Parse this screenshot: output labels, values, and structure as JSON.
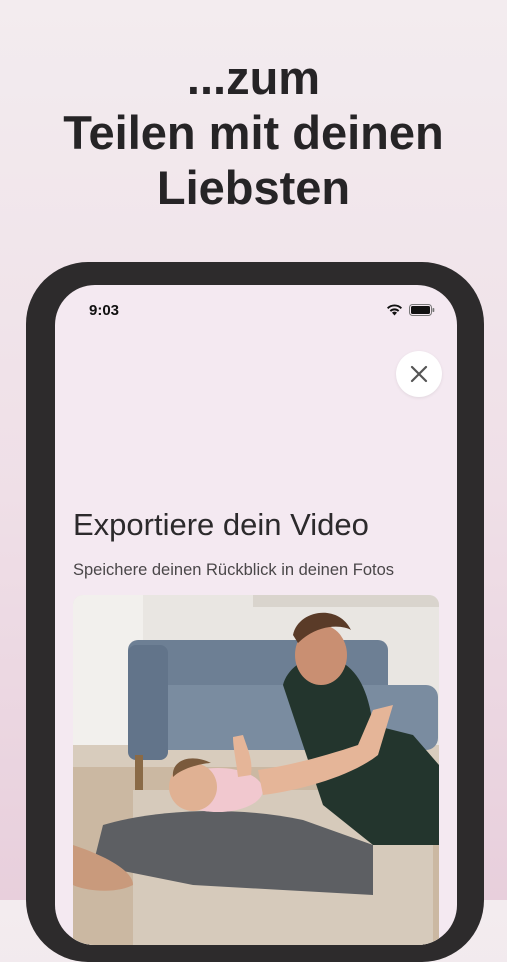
{
  "headline": {
    "line1": "...zum",
    "line2": "Teilen mit deinen",
    "line3": "Liebsten"
  },
  "status_bar": {
    "time": "9:03",
    "icons": [
      "wifi-icon",
      "battery-icon"
    ]
  },
  "screen": {
    "close_icon": "close-icon",
    "title": "Exportiere dein Video",
    "subtitle": "Speichere deinen Rückblick in deinen Fotos"
  },
  "colors": {
    "background": "#efdfe7",
    "phone_frame": "#2d2b2c",
    "screen": "#f4e9f1",
    "headline": "#262426"
  }
}
